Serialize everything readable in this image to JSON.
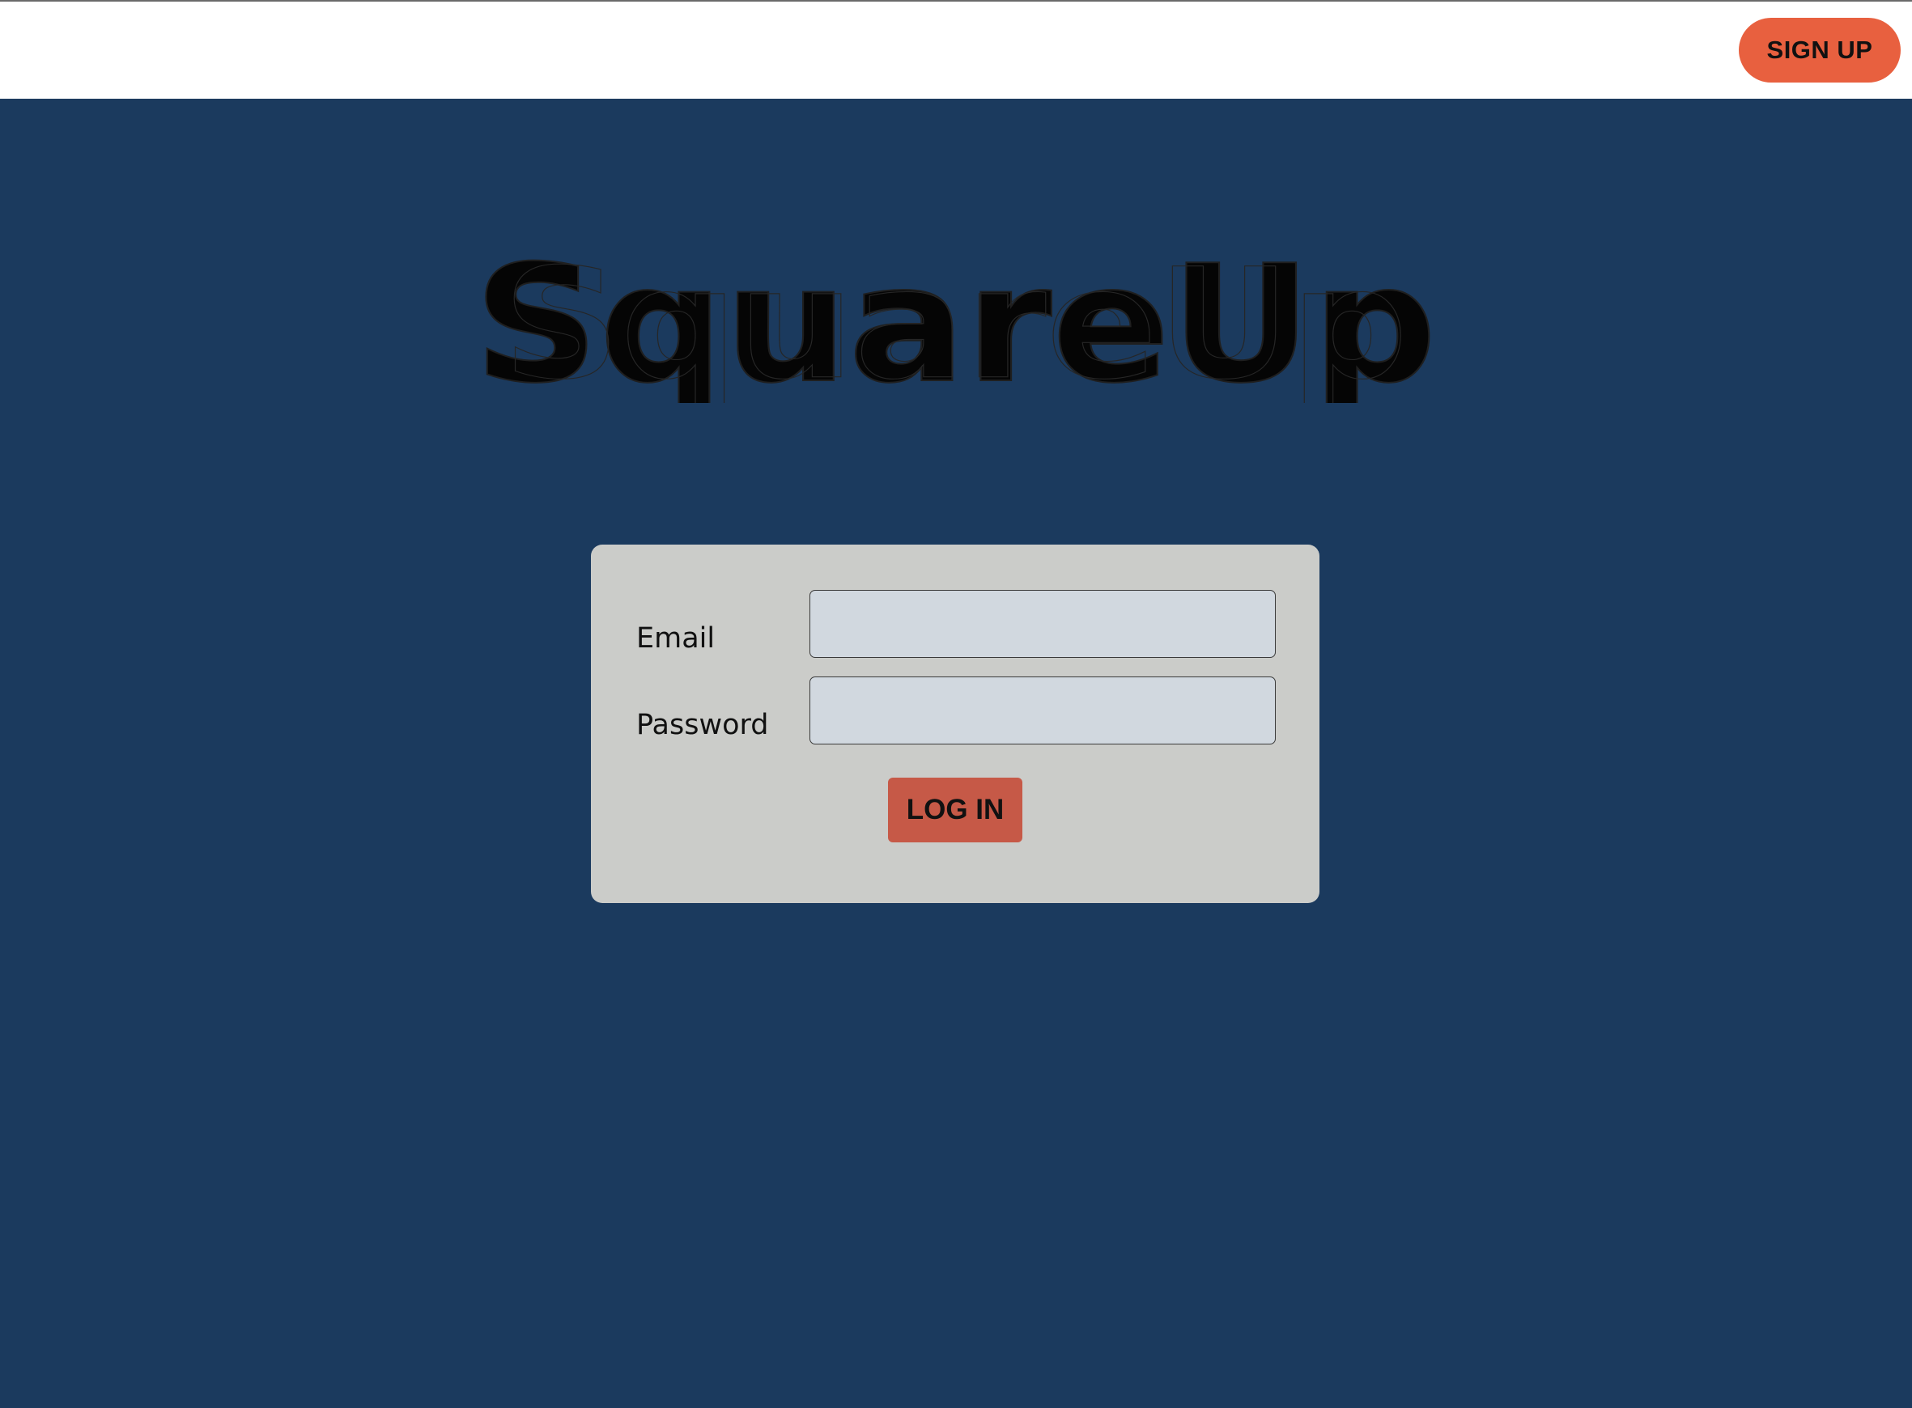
{
  "header": {
    "signup_label": "SIGN UP"
  },
  "brand": {
    "logo_text": "SquareUp"
  },
  "login_form": {
    "email_label": "Email",
    "email_value": "",
    "password_label": "Password",
    "password_value": "",
    "submit_label": "LOG IN"
  },
  "colors": {
    "background": "#1b3a5e",
    "topbar": "#ffffff",
    "signup_button": "#e8603f",
    "card": "#cbccc9",
    "input": "#d1d8df",
    "login_button": "#c65947"
  }
}
